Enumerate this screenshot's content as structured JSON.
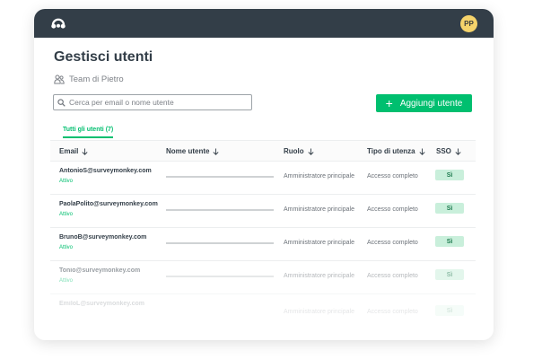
{
  "app": {
    "logo_icon": "surveymonkey-logo-icon",
    "avatar_initials": "PP"
  },
  "page": {
    "title": "Gestisci utenti",
    "team_icon": "users-group-icon",
    "team_name": "Team di Pietro"
  },
  "search": {
    "icon": "search-icon",
    "placeholder": "Cerca per email o nome utente",
    "value": ""
  },
  "add_button": {
    "icon": "plus-icon",
    "label": "Aggiungi utente"
  },
  "tabs": [
    {
      "label": "Tutti gli utenti (7)",
      "active": true
    }
  ],
  "table": {
    "columns": [
      {
        "label": "Email",
        "sort_icon": "arrow-down-icon"
      },
      {
        "label": "Nome utente",
        "sort_icon": "arrow-down-icon"
      },
      {
        "label": "Ruolo",
        "sort_icon": "arrow-down-icon"
      },
      {
        "label": "Tipo di utenza",
        "sort_icon": "arrow-down-icon"
      },
      {
        "label": "SSO",
        "sort_icon": "arrow-down-icon"
      }
    ],
    "rows": [
      {
        "email": "AntonioS@surveymonkey.com",
        "status": "Attivo",
        "role": "Amministratore principale",
        "access": "Accesso completo",
        "sso": "Sì"
      },
      {
        "email": "PaolaPolito@surveymonkey.com",
        "status": "Attivo",
        "role": "Amministratore principale",
        "access": "Accesso completo",
        "sso": "Sì"
      },
      {
        "email": "BrunoB@surveymonkey.com",
        "status": "Attivo",
        "role": "Amministratore principale",
        "access": "Accesso completo",
        "sso": "Sì"
      },
      {
        "email": "Tonio@surveymonkey.com",
        "status": "Attivo",
        "role": "Amministratore principale",
        "access": "Accesso completo",
        "sso": "Sì"
      },
      {
        "email": "EmiloL@surveymonkey.com",
        "status": "",
        "role": "Amministratore principale",
        "access": "Accesso completo",
        "sso": "Sì"
      }
    ]
  },
  "colors": {
    "topbar": "#333e48",
    "accent": "#00bf6f",
    "avatar": "#f5d36b",
    "sso_badge": "#c9efdb"
  }
}
